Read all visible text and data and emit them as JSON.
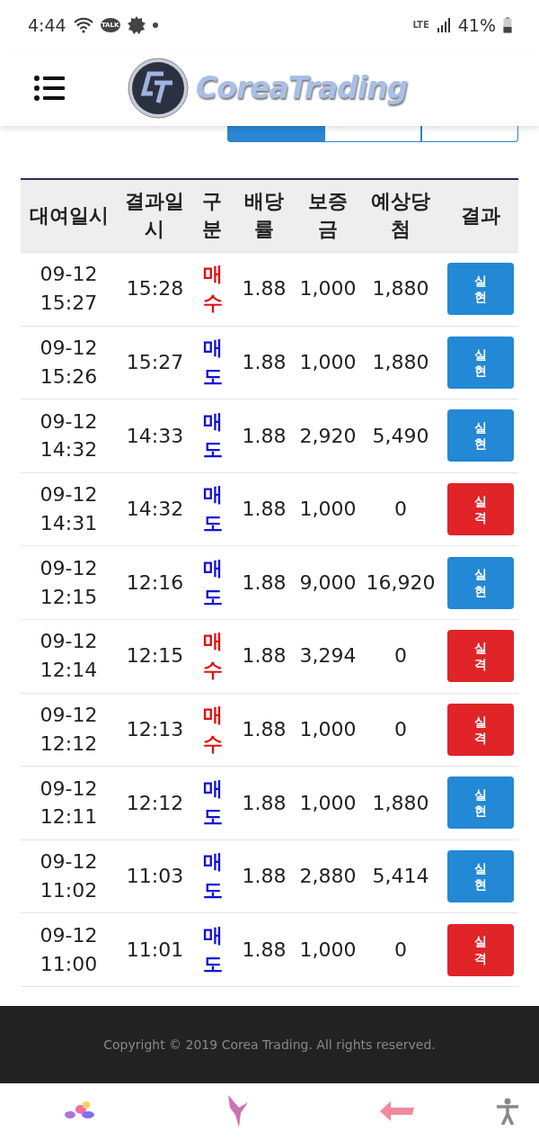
{
  "status_bar": {
    "time": "4:44",
    "chat_badge": "TALK",
    "network": "LTE",
    "battery": "41%"
  },
  "header": {
    "logo_text": "CoreaTrading"
  },
  "tabs": [
    {
      "selected": true
    },
    {
      "selected": false
    },
    {
      "selected": false
    }
  ],
  "table": {
    "columns": [
      "대여일시",
      "결과일시",
      "구분",
      "배당률",
      "보증금",
      "예상당첨",
      "결과"
    ],
    "rows": [
      {
        "date": "09-12 15:27",
        "result_time": "15:28",
        "side": {
          "label": "매수",
          "kind": "buy"
        },
        "rate": "1.88",
        "deposit": "1,000",
        "expected": "1,880",
        "result": {
          "label": "실현",
          "kind": "win"
        }
      },
      {
        "date": "09-12 15:26",
        "result_time": "15:27",
        "side": {
          "label": "매도",
          "kind": "sell"
        },
        "rate": "1.88",
        "deposit": "1,000",
        "expected": "1,880",
        "result": {
          "label": "실현",
          "kind": "win"
        }
      },
      {
        "date": "09-12 14:32",
        "result_time": "14:33",
        "side": {
          "label": "매도",
          "kind": "sell"
        },
        "rate": "1.88",
        "deposit": "2,920",
        "expected": "5,490",
        "result": {
          "label": "실현",
          "kind": "win"
        }
      },
      {
        "date": "09-12 14:31",
        "result_time": "14:32",
        "side": {
          "label": "매도",
          "kind": "sell"
        },
        "rate": "1.88",
        "deposit": "1,000",
        "expected": "0",
        "result": {
          "label": "실격",
          "kind": "loss"
        }
      },
      {
        "date": "09-12 12:15",
        "result_time": "12:16",
        "side": {
          "label": "매도",
          "kind": "sell"
        },
        "rate": "1.88",
        "deposit": "9,000",
        "expected": "16,920",
        "result": {
          "label": "실현",
          "kind": "win"
        }
      },
      {
        "date": "09-12 12:14",
        "result_time": "12:15",
        "side": {
          "label": "매수",
          "kind": "buy"
        },
        "rate": "1.88",
        "deposit": "3,294",
        "expected": "0",
        "result": {
          "label": "실격",
          "kind": "loss"
        }
      },
      {
        "date": "09-12 12:12",
        "result_time": "12:13",
        "side": {
          "label": "매수",
          "kind": "buy"
        },
        "rate": "1.88",
        "deposit": "1,000",
        "expected": "0",
        "result": {
          "label": "실격",
          "kind": "loss"
        }
      },
      {
        "date": "09-12 12:11",
        "result_time": "12:12",
        "side": {
          "label": "매도",
          "kind": "sell"
        },
        "rate": "1.88",
        "deposit": "1,000",
        "expected": "1,880",
        "result": {
          "label": "실현",
          "kind": "win"
        }
      },
      {
        "date": "09-12 11:02",
        "result_time": "11:03",
        "side": {
          "label": "매도",
          "kind": "sell"
        },
        "rate": "1.88",
        "deposit": "2,880",
        "expected": "5,414",
        "result": {
          "label": "실현",
          "kind": "win"
        }
      },
      {
        "date": "09-12 11:00",
        "result_time": "11:01",
        "side": {
          "label": "매도",
          "kind": "sell"
        },
        "rate": "1.88",
        "deposit": "1,000",
        "expected": "0",
        "result": {
          "label": "실격",
          "kind": "loss"
        }
      }
    ]
  },
  "footer": {
    "copyright": "Copyright © 2019 Corea Trading. All rights reserved."
  }
}
